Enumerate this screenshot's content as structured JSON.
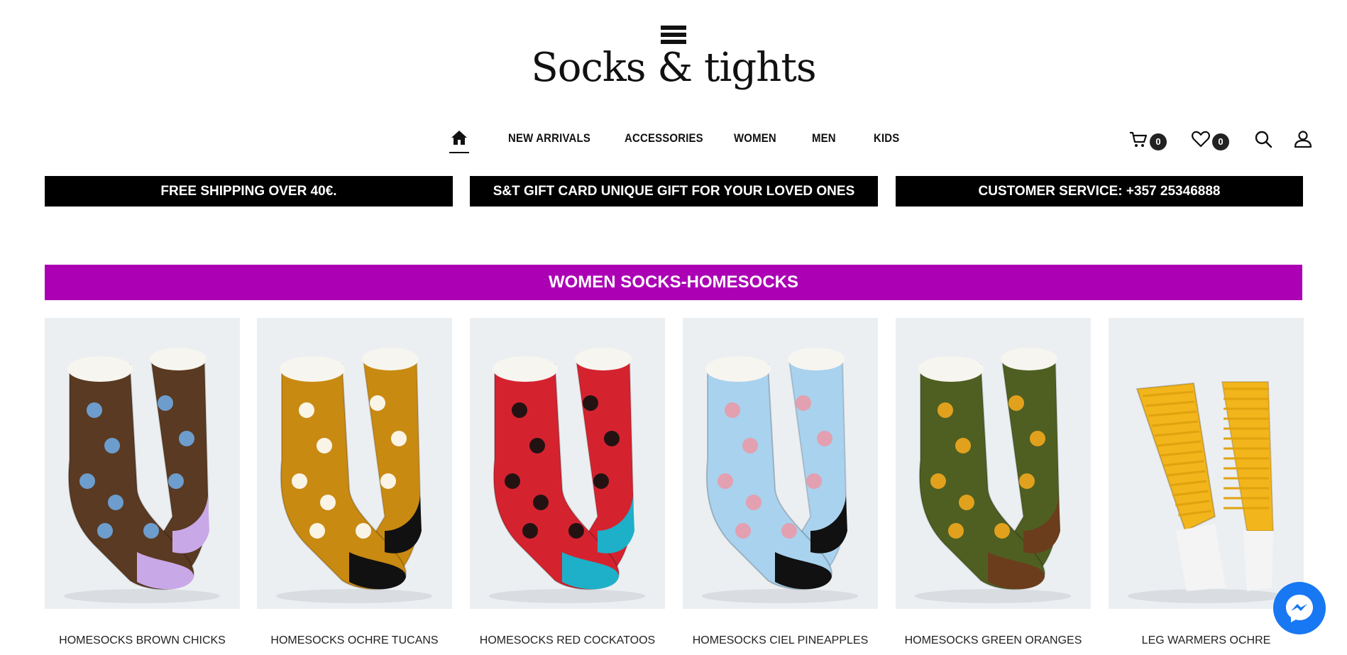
{
  "brand": {
    "logo_text": "Socks & tights"
  },
  "nav": {
    "home_icon": "home-icon",
    "items": [
      "NEW ARRIVALS",
      "ACCESSORIES",
      "WOMEN",
      "MEN",
      "KIDS"
    ]
  },
  "tools": {
    "cart_icon": "cart-icon",
    "cart_count": "0",
    "wishlist_icon": "heart-icon",
    "wishlist_count": "0",
    "search_icon": "search-icon",
    "account_icon": "user-icon"
  },
  "banners": [
    "FREE SHIPPING OVER 40€.",
    "S&T GIFT CARD UNIQUE GIFT FOR YOUR LOVED ONES",
    "CUSTOMER SERVICE: +357 25346888"
  ],
  "section": {
    "title": "WOMEN SOCKS-HOMESOCKS",
    "color": "#ab00b4"
  },
  "products": [
    {
      "name": "HOMESOCKS BROWN CHICKS",
      "main": "#5a3a22",
      "accent": "#c9a8e8",
      "pattern": "#6fa8e0"
    },
    {
      "name": "HOMESOCKS OCHRE TUCANS",
      "main": "#c98a12",
      "accent": "#111111",
      "pattern": "#ffffff"
    },
    {
      "name": "HOMESOCKS RED COCKATOOS",
      "main": "#d4232f",
      "accent": "#1eb0c8",
      "pattern": "#111111"
    },
    {
      "name": "HOMESOCKS CIEL PINEAPPLES",
      "main": "#a9d2ee",
      "accent": "#111111",
      "pattern": "#e89aa8"
    },
    {
      "name": "HOMESOCKS GREEN ORANGES",
      "main": "#4f5f22",
      "accent": "#6b3d1c",
      "pattern": "#f2a81d"
    },
    {
      "name": "LEG WARMERS OCHRE",
      "main": "#f2b51b",
      "accent": "#ffffff",
      "pattern": "#e0a20e"
    }
  ],
  "chat": {
    "icon": "messenger-icon",
    "color": "#1877f2"
  }
}
